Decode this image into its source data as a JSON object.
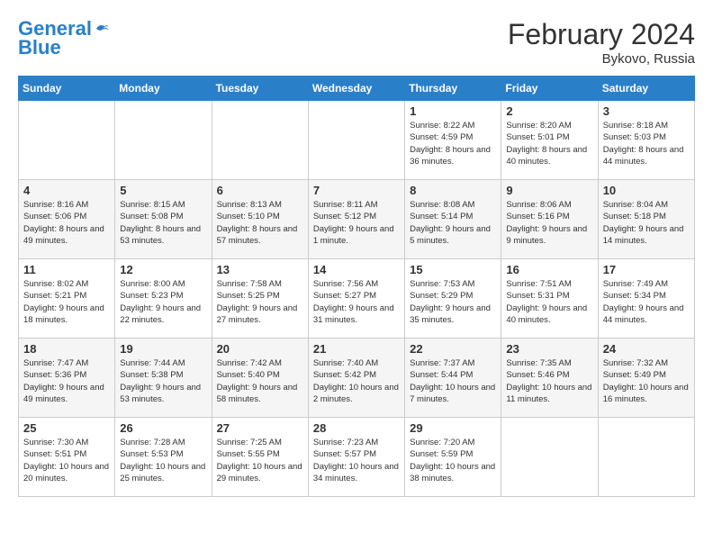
{
  "header": {
    "logo_line1": "General",
    "logo_line2": "Blue",
    "month_year": "February 2024",
    "location": "Bykovo, Russia"
  },
  "weekdays": [
    "Sunday",
    "Monday",
    "Tuesday",
    "Wednesday",
    "Thursday",
    "Friday",
    "Saturday"
  ],
  "weeks": [
    [
      {
        "day": "",
        "empty": true
      },
      {
        "day": "",
        "empty": true
      },
      {
        "day": "",
        "empty": true
      },
      {
        "day": "",
        "empty": true
      },
      {
        "day": "1",
        "sunrise": "8:22 AM",
        "sunset": "4:59 PM",
        "daylight": "8 hours and 36 minutes."
      },
      {
        "day": "2",
        "sunrise": "8:20 AM",
        "sunset": "5:01 PM",
        "daylight": "8 hours and 40 minutes."
      },
      {
        "day": "3",
        "sunrise": "8:18 AM",
        "sunset": "5:03 PM",
        "daylight": "8 hours and 44 minutes."
      }
    ],
    [
      {
        "day": "4",
        "sunrise": "8:16 AM",
        "sunset": "5:06 PM",
        "daylight": "8 hours and 49 minutes."
      },
      {
        "day": "5",
        "sunrise": "8:15 AM",
        "sunset": "5:08 PM",
        "daylight": "8 hours and 53 minutes."
      },
      {
        "day": "6",
        "sunrise": "8:13 AM",
        "sunset": "5:10 PM",
        "daylight": "8 hours and 57 minutes."
      },
      {
        "day": "7",
        "sunrise": "8:11 AM",
        "sunset": "5:12 PM",
        "daylight": "9 hours and 1 minute."
      },
      {
        "day": "8",
        "sunrise": "8:08 AM",
        "sunset": "5:14 PM",
        "daylight": "9 hours and 5 minutes."
      },
      {
        "day": "9",
        "sunrise": "8:06 AM",
        "sunset": "5:16 PM",
        "daylight": "9 hours and 9 minutes."
      },
      {
        "day": "10",
        "sunrise": "8:04 AM",
        "sunset": "5:18 PM",
        "daylight": "9 hours and 14 minutes."
      }
    ],
    [
      {
        "day": "11",
        "sunrise": "8:02 AM",
        "sunset": "5:21 PM",
        "daylight": "9 hours and 18 minutes."
      },
      {
        "day": "12",
        "sunrise": "8:00 AM",
        "sunset": "5:23 PM",
        "daylight": "9 hours and 22 minutes."
      },
      {
        "day": "13",
        "sunrise": "7:58 AM",
        "sunset": "5:25 PM",
        "daylight": "9 hours and 27 minutes."
      },
      {
        "day": "14",
        "sunrise": "7:56 AM",
        "sunset": "5:27 PM",
        "daylight": "9 hours and 31 minutes."
      },
      {
        "day": "15",
        "sunrise": "7:53 AM",
        "sunset": "5:29 PM",
        "daylight": "9 hours and 35 minutes."
      },
      {
        "day": "16",
        "sunrise": "7:51 AM",
        "sunset": "5:31 PM",
        "daylight": "9 hours and 40 minutes."
      },
      {
        "day": "17",
        "sunrise": "7:49 AM",
        "sunset": "5:34 PM",
        "daylight": "9 hours and 44 minutes."
      }
    ],
    [
      {
        "day": "18",
        "sunrise": "7:47 AM",
        "sunset": "5:36 PM",
        "daylight": "9 hours and 49 minutes."
      },
      {
        "day": "19",
        "sunrise": "7:44 AM",
        "sunset": "5:38 PM",
        "daylight": "9 hours and 53 minutes."
      },
      {
        "day": "20",
        "sunrise": "7:42 AM",
        "sunset": "5:40 PM",
        "daylight": "9 hours and 58 minutes."
      },
      {
        "day": "21",
        "sunrise": "7:40 AM",
        "sunset": "5:42 PM",
        "daylight": "10 hours and 2 minutes."
      },
      {
        "day": "22",
        "sunrise": "7:37 AM",
        "sunset": "5:44 PM",
        "daylight": "10 hours and 7 minutes."
      },
      {
        "day": "23",
        "sunrise": "7:35 AM",
        "sunset": "5:46 PM",
        "daylight": "10 hours and 11 minutes."
      },
      {
        "day": "24",
        "sunrise": "7:32 AM",
        "sunset": "5:49 PM",
        "daylight": "10 hours and 16 minutes."
      }
    ],
    [
      {
        "day": "25",
        "sunrise": "7:30 AM",
        "sunset": "5:51 PM",
        "daylight": "10 hours and 20 minutes."
      },
      {
        "day": "26",
        "sunrise": "7:28 AM",
        "sunset": "5:53 PM",
        "daylight": "10 hours and 25 minutes."
      },
      {
        "day": "27",
        "sunrise": "7:25 AM",
        "sunset": "5:55 PM",
        "daylight": "10 hours and 29 minutes."
      },
      {
        "day": "28",
        "sunrise": "7:23 AM",
        "sunset": "5:57 PM",
        "daylight": "10 hours and 34 minutes."
      },
      {
        "day": "29",
        "sunrise": "7:20 AM",
        "sunset": "5:59 PM",
        "daylight": "10 hours and 38 minutes."
      },
      {
        "day": "",
        "empty": true
      },
      {
        "day": "",
        "empty": true
      }
    ]
  ]
}
